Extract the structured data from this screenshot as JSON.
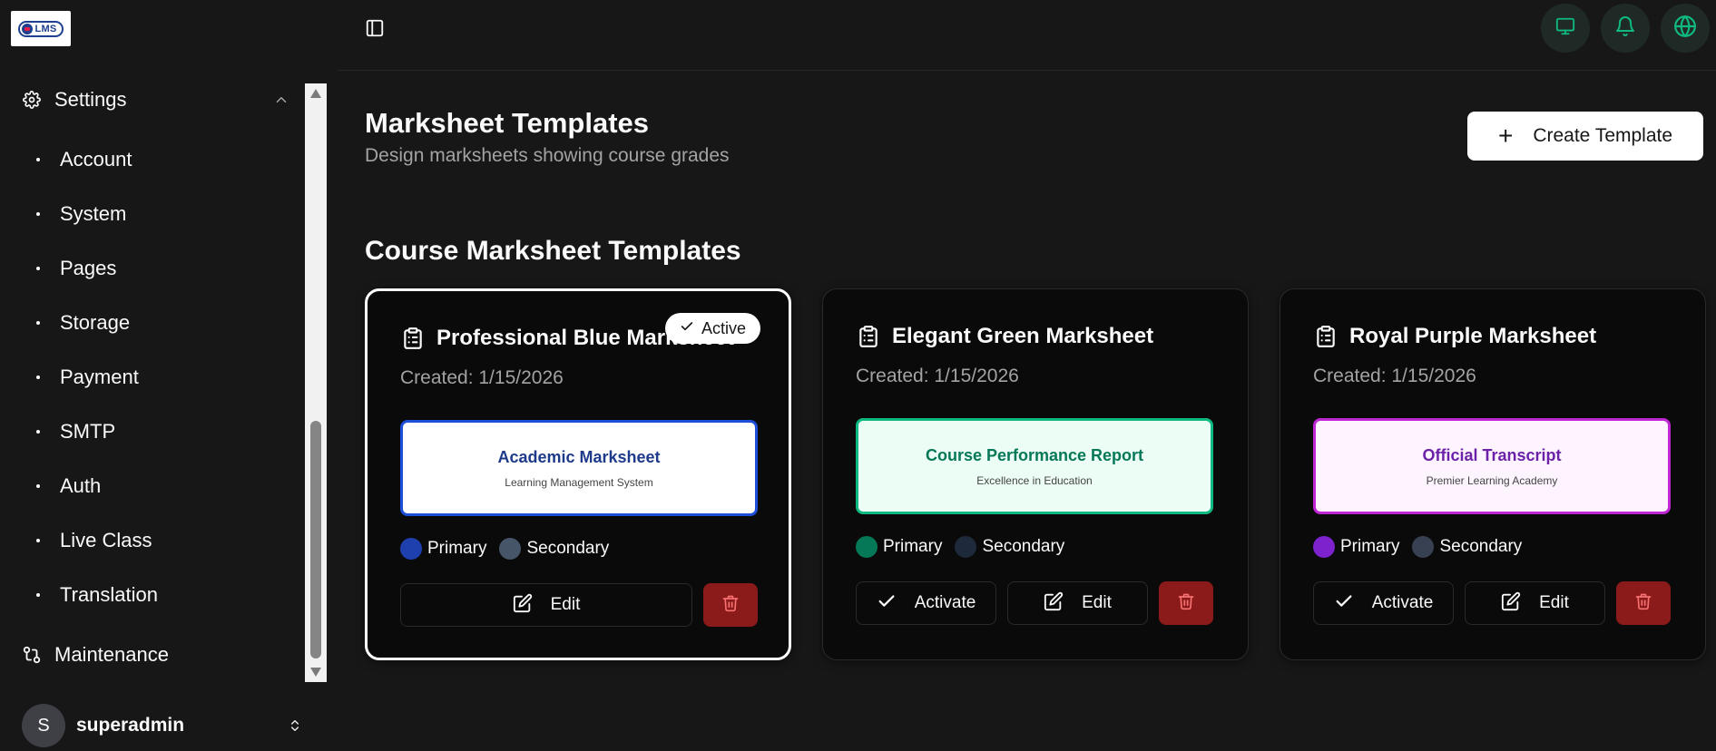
{
  "logo": {
    "text": "LMS"
  },
  "sidebar": {
    "settings_label": "Settings",
    "items": [
      {
        "label": "Account"
      },
      {
        "label": "System"
      },
      {
        "label": "Pages"
      },
      {
        "label": "Storage"
      },
      {
        "label": "Payment"
      },
      {
        "label": "SMTP"
      },
      {
        "label": "Auth"
      },
      {
        "label": "Live Class"
      },
      {
        "label": "Translation"
      }
    ],
    "maintenance_label": "Maintenance"
  },
  "user": {
    "initial": "S",
    "name": "superadmin"
  },
  "header": {
    "icons": [
      "monitor-icon",
      "bell-icon",
      "globe-icon"
    ]
  },
  "page": {
    "title": "Marksheet Templates",
    "subtitle": "Design marksheets showing course grades",
    "create_label": "Create Template",
    "section_title": "Course Marksheet Templates"
  },
  "labels": {
    "primary": "Primary",
    "secondary": "Secondary",
    "edit": "Edit",
    "activate": "Activate",
    "active": "Active"
  },
  "cards": [
    {
      "name": "Professional Blue Marksheet",
      "created": "Created: 1/15/2026",
      "active": true,
      "preview_title": "Academic Marksheet",
      "preview_subtitle": "Learning Management System",
      "primary_color": "#1e40af",
      "secondary_color": "#475569",
      "preview_bg": "#ffffff"
    },
    {
      "name": "Elegant Green Marksheet",
      "created": "Created: 1/15/2026",
      "active": false,
      "preview_title": "Course Performance Report",
      "preview_subtitle": "Excellence in Education",
      "primary_color": "#047857",
      "secondary_color": "#1e293b",
      "preview_bg": "#ecfdf5"
    },
    {
      "name": "Royal Purple Marksheet",
      "created": "Created: 1/15/2026",
      "active": false,
      "preview_title": "Official Transcript",
      "preview_subtitle": "Premier Learning Academy",
      "primary_color": "#7e22ce",
      "secondary_color": "#374151",
      "preview_bg": "#fdf4ff"
    }
  ],
  "colors": {
    "accent_green": "#10b981",
    "delete_red": "#8b1a1a",
    "preview_border_blue": "#1d4ed8",
    "preview_border_green": "#10b981",
    "preview_border_purple": "#c026d3"
  }
}
